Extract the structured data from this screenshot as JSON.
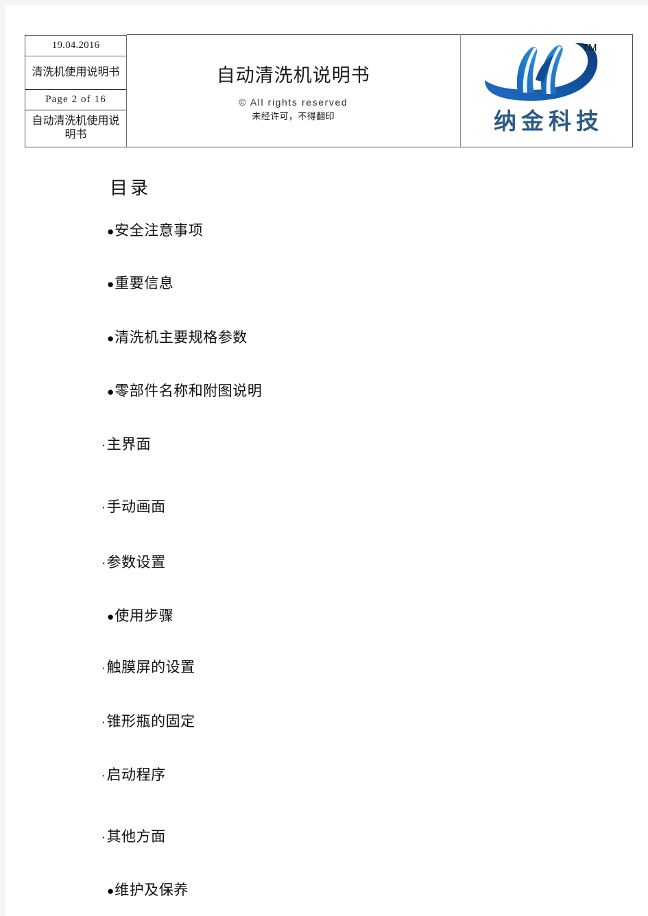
{
  "header": {
    "meta": {
      "date": "19.04.2016",
      "doc_subtitle_top": "清洗机使用说明书",
      "page_label": "Page 2 of 16",
      "doc_subtitle_bottom": "自动清洗机使用说明书"
    },
    "title": "自动清洗机说明书",
    "rights_en": "© All rights reserved",
    "rights_cn": "未经许可，不得翻印",
    "logo": {
      "trademark": "TM",
      "company_name": "纳金科技",
      "mark_color_dark": "#0d3f7a",
      "mark_color_light": "#2f8fd8",
      "name_color": "#2a5a85"
    }
  },
  "toc": {
    "heading": "目录",
    "items": [
      {
        "marker": "●",
        "label": "安全注意事项",
        "level": 1,
        "gap_after": 54
      },
      {
        "marker": "●",
        "label": "重要信息",
        "level": 1,
        "gap_after": 56
      },
      {
        "marker": "●",
        "label": "清洗机主要规格参数",
        "level": 1,
        "gap_after": 55
      },
      {
        "marker": "●",
        "label": "零部件名称和附图说明",
        "level": 1,
        "gap_after": 55
      },
      {
        "marker": "·",
        "label": "主界面",
        "level": 2,
        "gap_after": 68
      },
      {
        "marker": "·",
        "label": "手动画面",
        "level": 2,
        "gap_after": 57
      },
      {
        "marker": "·",
        "label": "参数设置",
        "level": 2,
        "gap_after": 55
      },
      {
        "marker": "●",
        "label": "使用步骤",
        "level": 1,
        "gap_after": 52
      },
      {
        "marker": "·",
        "label": "触膜屏的设置",
        "level": 2,
        "gap_after": 56
      },
      {
        "marker": "·",
        "label": "锥形瓶的固定",
        "level": 2,
        "gap_after": 55
      },
      {
        "marker": "·",
        "label": "启动程序",
        "level": 2,
        "gap_after": 67
      },
      {
        "marker": "·",
        "label": "其他方面",
        "level": 2,
        "gap_after": 55
      },
      {
        "marker": "●",
        "label": "维护及保养",
        "level": 1,
        "gap_after": 0
      }
    ]
  }
}
